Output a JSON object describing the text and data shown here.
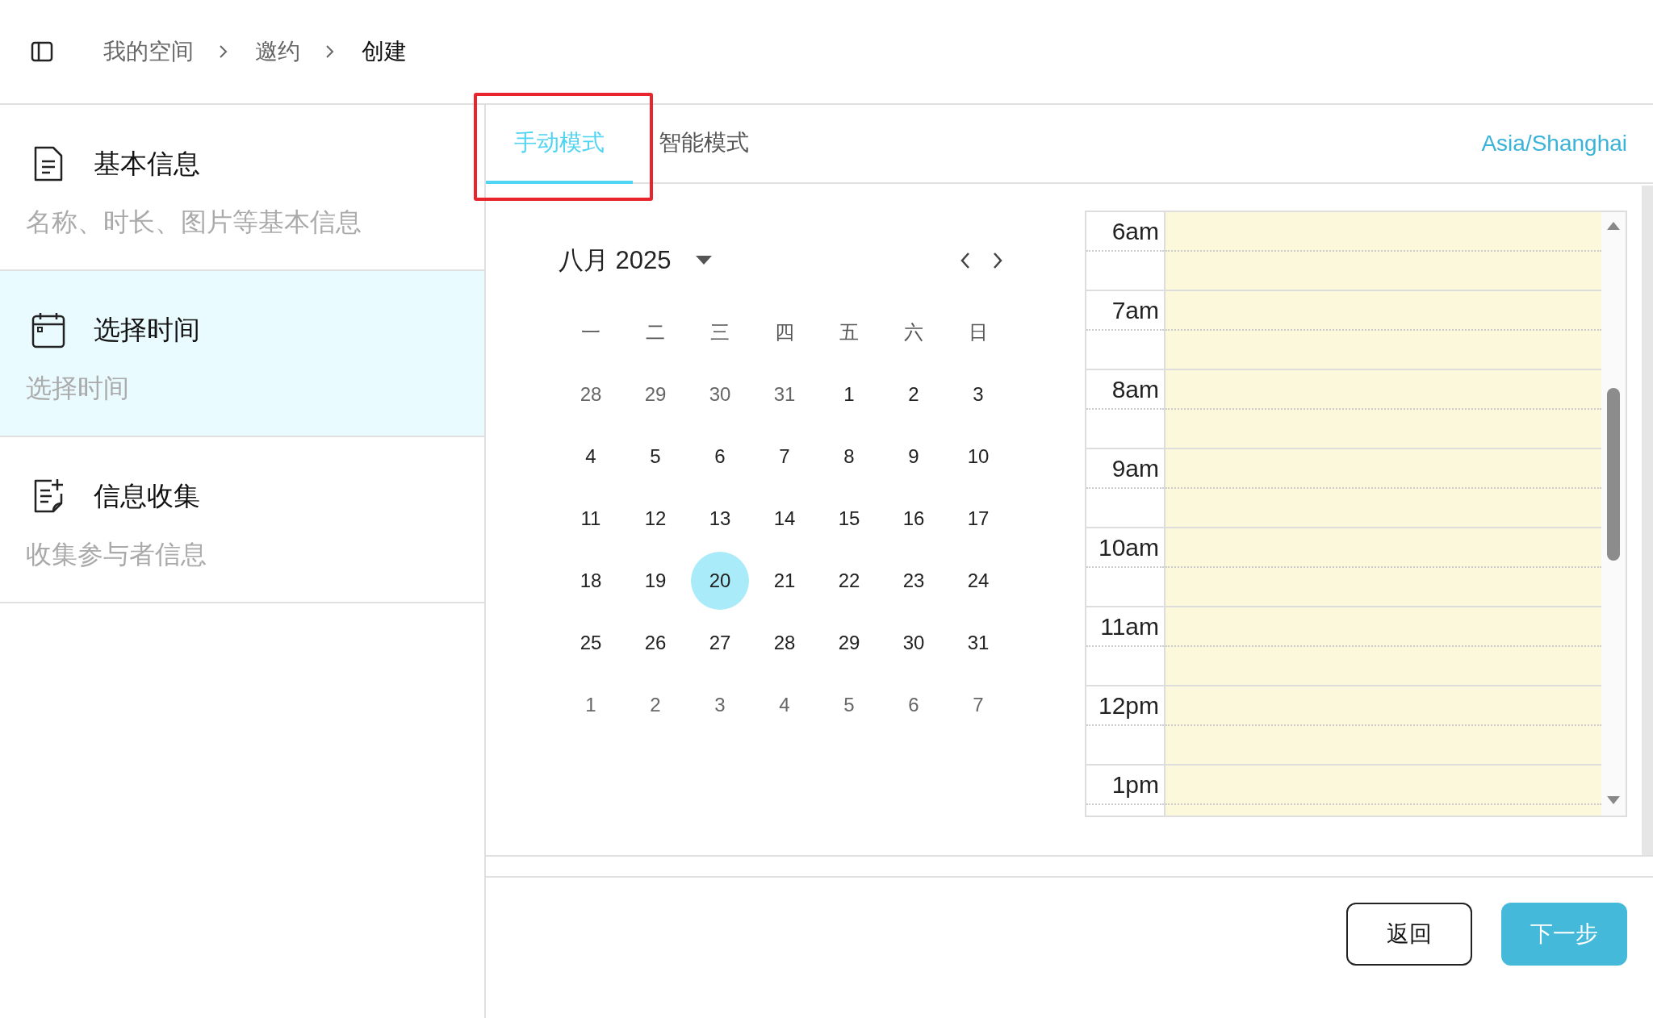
{
  "breadcrumbs": [
    {
      "label": "我的空间",
      "current": false
    },
    {
      "label": "邀约",
      "current": false
    },
    {
      "label": "创建",
      "current": true
    }
  ],
  "steps": [
    {
      "title": "基本信息",
      "subtitle": "名称、时长、图片等基本信息",
      "selected": false
    },
    {
      "title": "选择时间",
      "subtitle": "选择时间",
      "selected": true
    },
    {
      "title": "信息收集",
      "subtitle": "收集参与者信息",
      "selected": false
    }
  ],
  "tabs": [
    {
      "label": "手动模式",
      "selected": true
    },
    {
      "label": "智能模式",
      "selected": false
    }
  ],
  "timezone": "Asia/Shanghai",
  "calendar": {
    "month_title": "八月 2025",
    "weekdays": [
      "一",
      "二",
      "三",
      "四",
      "五",
      "六",
      "日"
    ],
    "weeks": [
      [
        {
          "day": "28",
          "outside": true,
          "selected": false
        },
        {
          "day": "29",
          "outside": true,
          "selected": false
        },
        {
          "day": "30",
          "outside": true,
          "selected": false
        },
        {
          "day": "31",
          "outside": true,
          "selected": false
        },
        {
          "day": "1",
          "outside": false,
          "selected": false
        },
        {
          "day": "2",
          "outside": false,
          "selected": false
        },
        {
          "day": "3",
          "outside": false,
          "selected": false
        }
      ],
      [
        {
          "day": "4",
          "outside": false,
          "selected": false
        },
        {
          "day": "5",
          "outside": false,
          "selected": false
        },
        {
          "day": "6",
          "outside": false,
          "selected": false
        },
        {
          "day": "7",
          "outside": false,
          "selected": false
        },
        {
          "day": "8",
          "outside": false,
          "selected": false
        },
        {
          "day": "9",
          "outside": false,
          "selected": false
        },
        {
          "day": "10",
          "outside": false,
          "selected": false
        }
      ],
      [
        {
          "day": "11",
          "outside": false,
          "selected": false
        },
        {
          "day": "12",
          "outside": false,
          "selected": false
        },
        {
          "day": "13",
          "outside": false,
          "selected": false
        },
        {
          "day": "14",
          "outside": false,
          "selected": false
        },
        {
          "day": "15",
          "outside": false,
          "selected": false
        },
        {
          "day": "16",
          "outside": false,
          "selected": false
        },
        {
          "day": "17",
          "outside": false,
          "selected": false
        }
      ],
      [
        {
          "day": "18",
          "outside": false,
          "selected": false
        },
        {
          "day": "19",
          "outside": false,
          "selected": false
        },
        {
          "day": "20",
          "outside": false,
          "selected": true
        },
        {
          "day": "21",
          "outside": false,
          "selected": false
        },
        {
          "day": "22",
          "outside": false,
          "selected": false
        },
        {
          "day": "23",
          "outside": false,
          "selected": false
        },
        {
          "day": "24",
          "outside": false,
          "selected": false
        }
      ],
      [
        {
          "day": "25",
          "outside": false,
          "selected": false
        },
        {
          "day": "26",
          "outside": false,
          "selected": false
        },
        {
          "day": "27",
          "outside": false,
          "selected": false
        },
        {
          "day": "28",
          "outside": false,
          "selected": false
        },
        {
          "day": "29",
          "outside": false,
          "selected": false
        },
        {
          "day": "30",
          "outside": false,
          "selected": false
        },
        {
          "day": "31",
          "outside": false,
          "selected": false
        }
      ],
      [
        {
          "day": "1",
          "outside": true,
          "selected": false
        },
        {
          "day": "2",
          "outside": true,
          "selected": false
        },
        {
          "day": "3",
          "outside": true,
          "selected": false
        },
        {
          "day": "4",
          "outside": true,
          "selected": false
        },
        {
          "day": "5",
          "outside": true,
          "selected": false
        },
        {
          "day": "6",
          "outside": true,
          "selected": false
        },
        {
          "day": "7",
          "outside": true,
          "selected": false
        }
      ]
    ]
  },
  "time_grid": {
    "hours": [
      "6am",
      "7am",
      "8am",
      "9am",
      "10am",
      "11am",
      "12pm",
      "1pm"
    ]
  },
  "buttons": [
    {
      "label": "返回",
      "kind": "secondary"
    },
    {
      "label": "下一步",
      "kind": "primary"
    }
  ]
}
